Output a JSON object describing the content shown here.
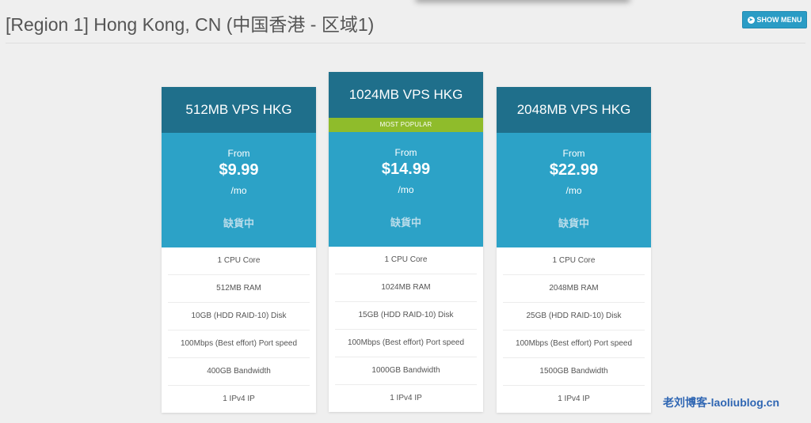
{
  "page": {
    "title": "[Region 1] Hong Kong, CN (中国香港 - 区域1)",
    "show_menu_label": "SHOW MENU",
    "show_menu_icon": "arrow-circle-right-icon"
  },
  "plans": [
    {
      "name": "512MB VPS HKG",
      "badge": "",
      "from": "From",
      "price": "$9.99",
      "period": "/mo",
      "status": "缺貨中",
      "features": [
        "1 CPU Core",
        "512MB RAM",
        "10GB (HDD RAID-10) Disk",
        "100Mbps (Best effort) Port speed",
        "400GB Bandwidth",
        "1 IPv4 IP"
      ]
    },
    {
      "name": "1024MB VPS HKG",
      "badge": "MOST POPULAR",
      "from": "From",
      "price": "$14.99",
      "period": "/mo",
      "status": "缺貨中",
      "features": [
        "1 CPU Core",
        "1024MB RAM",
        "15GB (HDD RAID-10) Disk",
        "100Mbps (Best effort) Port speed",
        "1000GB Bandwidth",
        "1 IPv4 IP"
      ]
    },
    {
      "name": "2048MB VPS HKG",
      "badge": "",
      "from": "From",
      "price": "$22.99",
      "period": "/mo",
      "status": "缺貨中",
      "features": [
        "1 CPU Core",
        "2048MB RAM",
        "25GB (HDD RAID-10) Disk",
        "100Mbps (Best effort) Port speed",
        "1500GB Bandwidth",
        "1 IPv4 IP"
      ]
    }
  ],
  "watermark": "老刘博客-laoliublog.cn",
  "colors": {
    "header": "#1f6f8b",
    "price_bg": "#2ca2c7",
    "badge": "#8fbc2b",
    "button": "#2a9cc5",
    "watermark": "#2f66b3"
  }
}
